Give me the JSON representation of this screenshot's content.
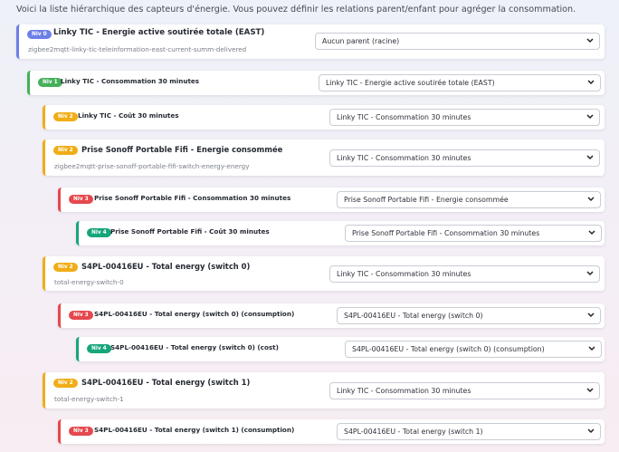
{
  "intro": "Voici la liste hiérarchique des capteurs d'énergie. Vous pouvez définir les relations parent/enfant pour agréger la consommation.",
  "colors": {
    "level0": "#6d7fe9",
    "level1": "#45b05a",
    "level2": "#f0ad17",
    "level3": "#e5484d",
    "level4": "#17a57a"
  },
  "sensors": [
    {
      "level": "Niv 0",
      "name": "Linky TIC - Energie active soutirée totale (EAST)",
      "entity": "zigbee2mqtt-linky-tic-teleinformation-east-current-summ-delivered",
      "parent": "Aucun parent (racine)"
    },
    {
      "level": "Niv 1",
      "name": "Linky TIC - Consommation 30 minutes",
      "entity": "",
      "parent": "Linky TIC - Energie active soutirée totale (EAST)"
    },
    {
      "level": "Niv 2",
      "name": "Linky TIC - Coût 30 minutes",
      "entity": "",
      "parent": "Linky TIC - Consommation 30 minutes"
    },
    {
      "level": "Niv 2",
      "name": "Prise Sonoff Portable Fifi - Energie consommée",
      "entity": "zigbee2mqtt-prise-sonoff-portable-fifi-switch-energy-energy",
      "parent": "Linky TIC - Consommation 30 minutes"
    },
    {
      "level": "Niv 3",
      "name": "Prise Sonoff Portable Fifi - Consommation 30 minutes",
      "entity": "",
      "parent": "Prise Sonoff Portable Fifi - Energie consommée"
    },
    {
      "level": "Niv 4",
      "name": "Prise Sonoff Portable Fifi - Coût 30 minutes",
      "entity": "",
      "parent": "Prise Sonoff Portable Fifi - Consommation 30 minutes"
    },
    {
      "level": "Niv 2",
      "name": "S4PL-00416EU - Total energy (switch 0)",
      "entity": "total-energy-switch-0",
      "parent": "Linky TIC - Consommation 30 minutes"
    },
    {
      "level": "Niv 3",
      "name": "S4PL-00416EU - Total energy (switch 0) (consumption)",
      "entity": "",
      "parent": "S4PL-00416EU - Total energy (switch 0)"
    },
    {
      "level": "Niv 4",
      "name": "S4PL-00416EU - Total energy (switch 0) (cost)",
      "entity": "",
      "parent": "S4PL-00416EU - Total energy (switch 0) (consumption)"
    },
    {
      "level": "Niv 2",
      "name": "S4PL-00416EU - Total energy (switch 1)",
      "entity": "total-energy-switch-1",
      "parent": "Linky TIC - Consommation 30 minutes"
    },
    {
      "level": "Niv 3",
      "name": "S4PL-00416EU - Total energy (switch 1) (consumption)",
      "entity": "",
      "parent": "S4PL-00416EU - Total energy (switch 1)"
    }
  ]
}
